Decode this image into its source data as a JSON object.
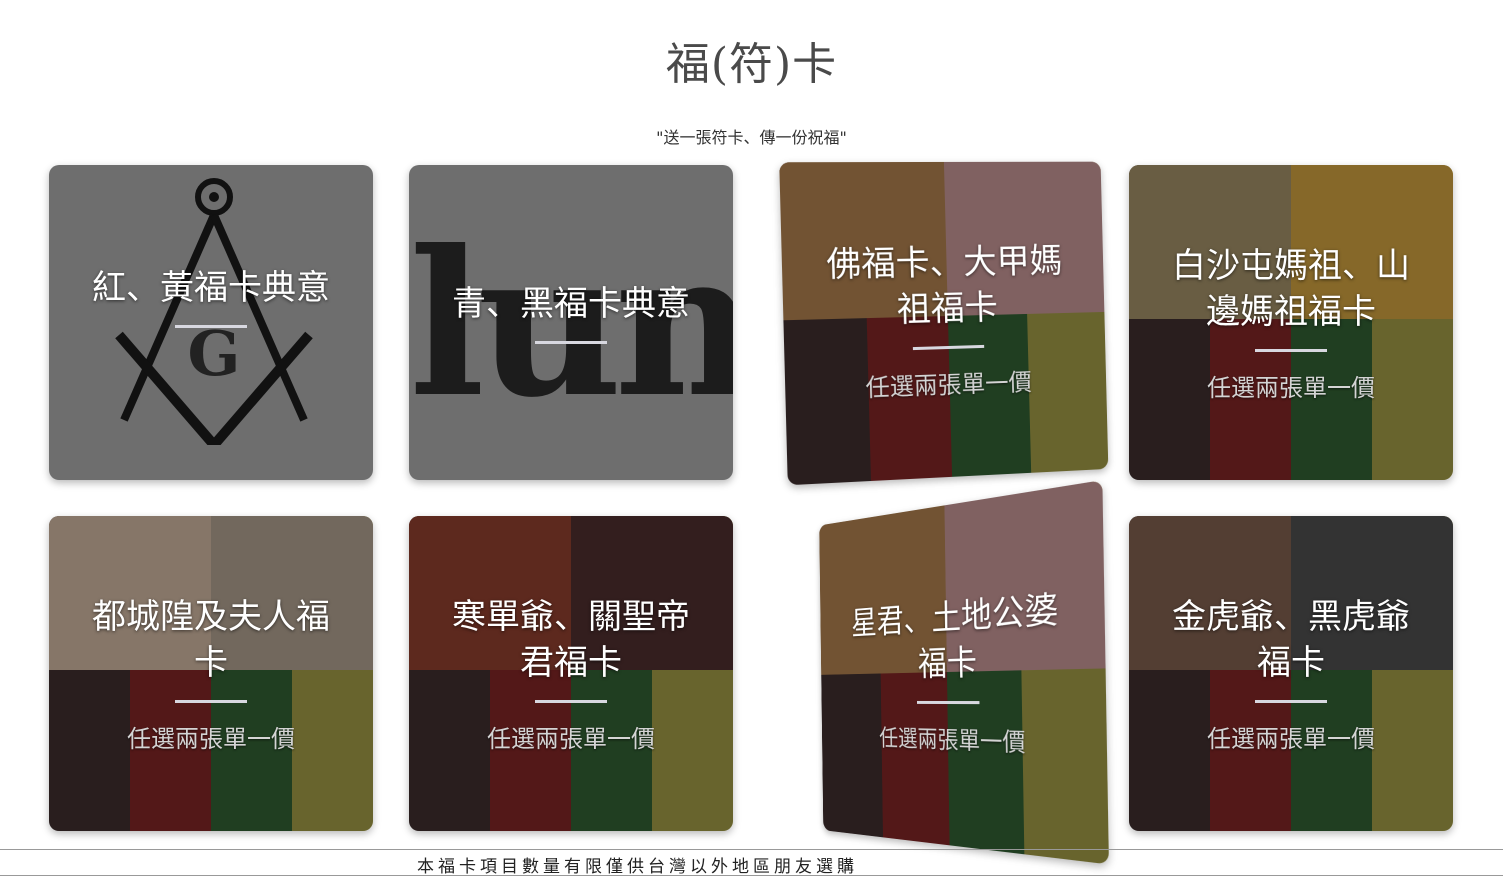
{
  "page": {
    "title": "福(符)卡",
    "subtitle": "\"送一張符卡、傳一份祝福\"",
    "footer": "本福卡項目數量有限僅供台灣以外地區朋友選購"
  },
  "cards": [
    {
      "title": "紅、黃福卡典意",
      "price": ""
    },
    {
      "title": "青、黑福卡典意",
      "price": ""
    },
    {
      "title": "佛福卡、大甲媽祖福卡",
      "price": "任選兩張單一價"
    },
    {
      "title": "白沙屯媽祖、山邊媽祖福卡",
      "price": "任選兩張單一價"
    },
    {
      "title": "都城隍及夫人福卡",
      "price": "任選兩張單一價"
    },
    {
      "title": "寒單爺、關聖帝君福卡",
      "price": "任選兩張單一價"
    },
    {
      "title": "星君、土地公婆福卡",
      "price": "任選兩張單一價"
    },
    {
      "title": "金虎爺、黑虎爺福卡",
      "price": "任選兩張單一價"
    }
  ],
  "decor": {
    "gothic_word": "luminati",
    "emblem_letter": "G"
  }
}
